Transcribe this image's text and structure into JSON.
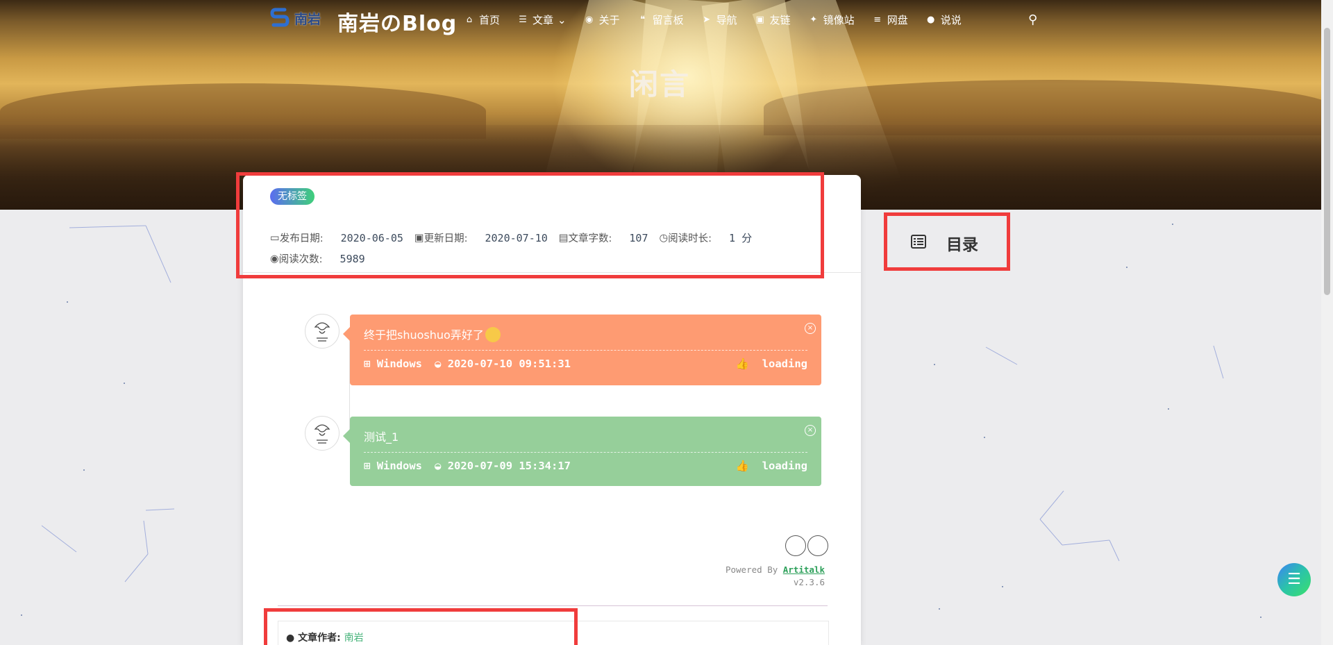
{
  "site": {
    "logo_text": "南岩",
    "title": "南岩のBlog"
  },
  "nav": [
    {
      "icon": "home-icon",
      "glyph": "⌂",
      "label": "首页"
    },
    {
      "icon": "list-icon",
      "glyph": "☰",
      "label": "文章",
      "dropdown": true
    },
    {
      "icon": "user-circle-icon",
      "glyph": "◉",
      "label": "关于"
    },
    {
      "icon": "comments-icon",
      "glyph": "❝",
      "label": "留言板"
    },
    {
      "icon": "location-arrow-icon",
      "glyph": "➤",
      "label": "导航"
    },
    {
      "icon": "address-card-icon",
      "glyph": "▣",
      "label": "友链"
    },
    {
      "icon": "users-icon",
      "glyph": "✦",
      "label": "镜像站"
    },
    {
      "icon": "database-icon",
      "glyph": "≡",
      "label": "网盘"
    },
    {
      "icon": "comment-icon",
      "glyph": "●",
      "label": "说说"
    }
  ],
  "hero": {
    "title": "闲言"
  },
  "post": {
    "tag": "无标签",
    "published_label": "发布日期:",
    "published": "2020-06-05",
    "updated_label": "更新日期:",
    "updated": "2020-07-10",
    "words_label": "文章字数:",
    "words": "107",
    "read_time_label": "阅读时长:",
    "read_time": "1 分",
    "views_label": "阅读次数:",
    "views": "5989"
  },
  "shuoshuo": [
    {
      "text": "终于把shuoshuo弄好了",
      "os": "Windows",
      "time": "2020-07-10 09:51:31",
      "likes": "loading",
      "color": "#fe9b72"
    },
    {
      "text": "测试_1",
      "os": "Windows",
      "time": "2020-07-09 15:34:17",
      "likes": "loading",
      "color": "#96cf9a"
    }
  ],
  "artitalk": {
    "powered_by": "Powered By",
    "link": "Artitalk",
    "version": "v2.3.6"
  },
  "author": {
    "label": "文章作者:",
    "name": "南岩"
  },
  "toc": {
    "label": "目录"
  },
  "colors": {
    "highlight": "#f03c3c",
    "accent_green": "#46b37a"
  }
}
